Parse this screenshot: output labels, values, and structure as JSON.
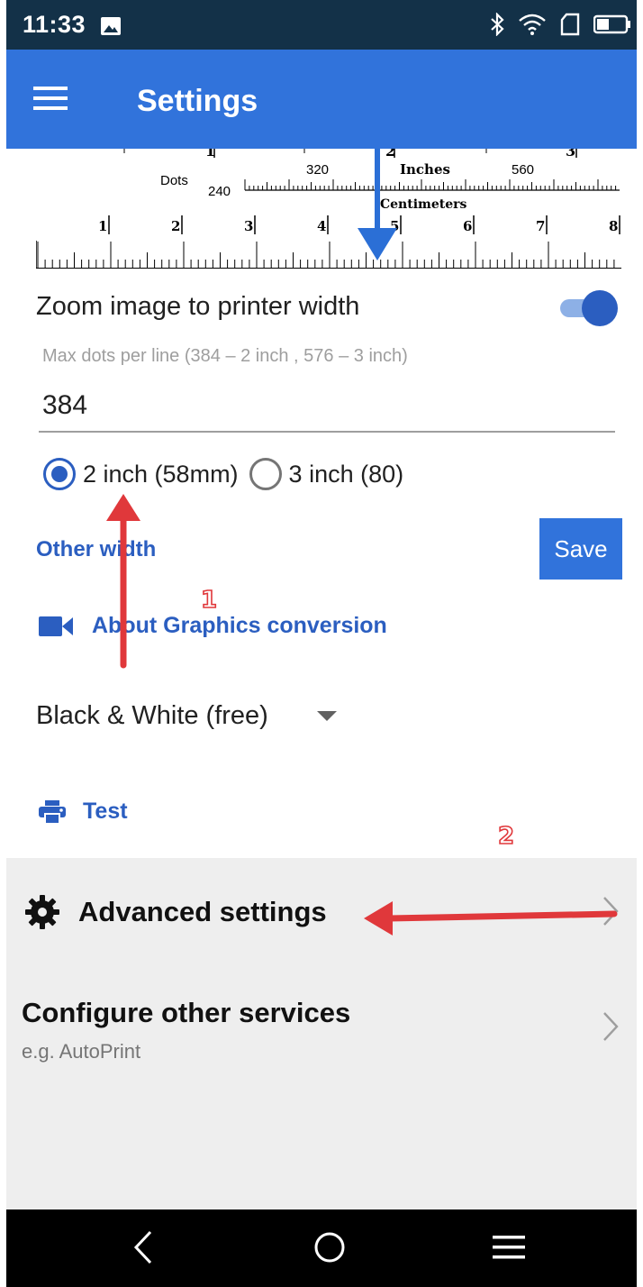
{
  "status_bar": {
    "time": "11:33"
  },
  "app_bar": {
    "title": "Settings"
  },
  "ruler": {
    "dots_label": "Dots",
    "dot_values": [
      "240",
      "320",
      "560"
    ],
    "inches_label": "Inches",
    "centimeters_label": "Centimeters",
    "inch_numbers": [
      "1",
      "2",
      "3",
      "4",
      "5",
      "6",
      "7",
      "8"
    ]
  },
  "zoom": {
    "label": "Zoom image to printer width",
    "enabled": true
  },
  "dots_per_line": {
    "hint": "Max dots per line (384 – 2 inch , 576 – 3 inch)",
    "value": "384"
  },
  "width_options": [
    {
      "label": "2 inch (58mm)",
      "selected": true
    },
    {
      "label": "3 inch (80)",
      "selected": false
    }
  ],
  "other_width_label": "Other width",
  "save_label": "Save",
  "about_label": "About Graphics conversion",
  "mode_select": {
    "value": "Black & White (free)"
  },
  "test_label": "Test",
  "advanced": {
    "label": "Advanced settings"
  },
  "configure": {
    "title": "Configure other services",
    "subtitle": "e.g. AutoPrint"
  },
  "annotations": {
    "one": "1",
    "two": "2"
  },
  "colors": {
    "status_bar": "#133148",
    "app_bar": "#3173DB",
    "accent": "#2B5EC0",
    "annotation_arrow": "#E0383B",
    "section_bg": "#EEEEEE"
  }
}
